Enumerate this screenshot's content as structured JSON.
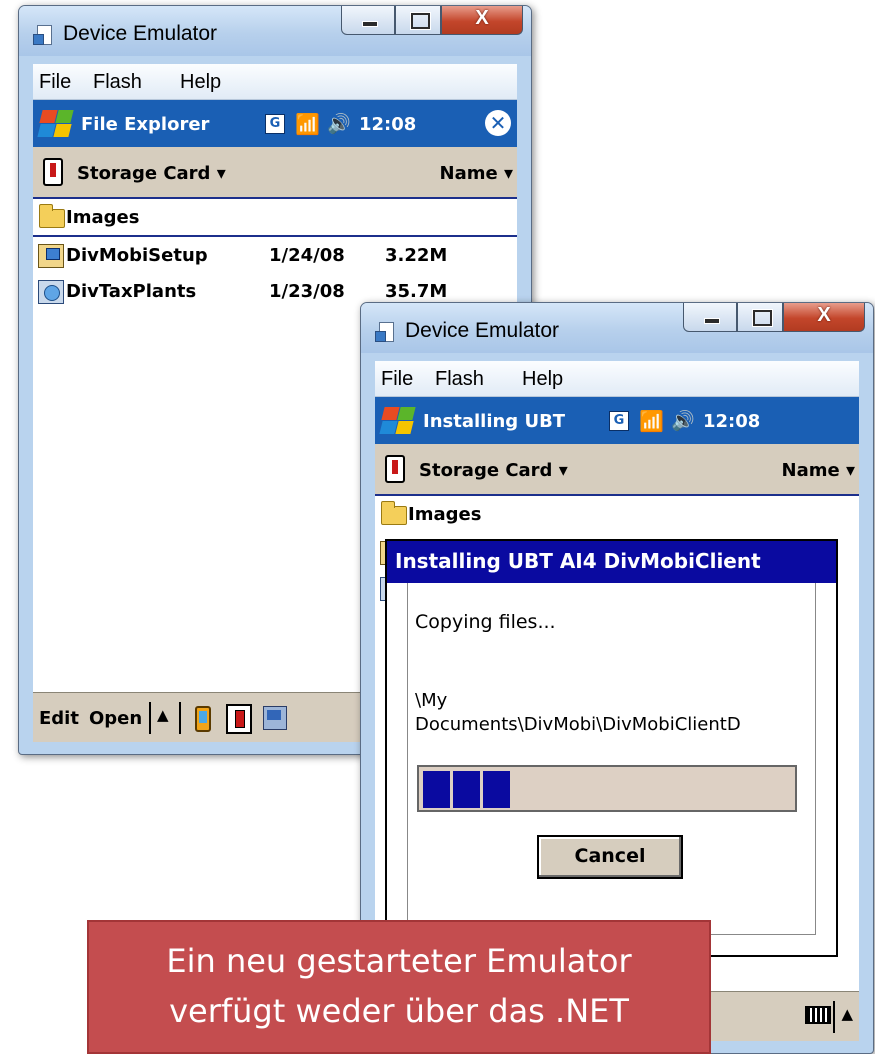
{
  "window_back": {
    "title": "Device Emulator",
    "menu": [
      "File",
      "Flash",
      "Help"
    ],
    "navbar": {
      "app_title": "File Explorer",
      "badge": "G",
      "clock": "12:08"
    },
    "storage": {
      "location": "Storage Card",
      "sort": "Name"
    },
    "folders": [
      {
        "name": "Images"
      }
    ],
    "files": [
      {
        "name": "DivMobiSetup",
        "date": "1/24/08",
        "size": "3.22M"
      },
      {
        "name": "DivTaxPlants",
        "date": "1/23/08",
        "size": "35.7M"
      }
    ],
    "bottom": {
      "edit": "Edit",
      "open": "Open"
    }
  },
  "window_front": {
    "title": "Device Emulator",
    "menu": [
      "File",
      "Flash",
      "Help"
    ],
    "navbar": {
      "app_title": "Installing UBT",
      "badge": "G",
      "clock": "12:08"
    },
    "storage": {
      "location": "Storage Card",
      "sort": "Name"
    },
    "folders": [
      {
        "name": "Images"
      }
    ],
    "dialog": {
      "title": "Installing UBT AI4 DivMobiClient",
      "status": "Copying files...",
      "path_line1": "\\My",
      "path_line2": "Documents\\DivMobi\\DivMobiClientD",
      "progress_blocks": 3,
      "cancel": "Cancel"
    }
  },
  "callout": {
    "line1": "Ein neu gestarteter Emulator",
    "line2": "verfügt weder über das .NET"
  },
  "icons": [
    "windows-flag-icon",
    "signal-icon",
    "speaker-icon",
    "close-circle-icon",
    "storage-card-icon",
    "folder-icon",
    "setup-package-icon",
    "application-icon",
    "pda-icon",
    "desktop-sync-icon",
    "keyboard-icon"
  ],
  "colors": {
    "navbar": "#1a5fb4",
    "dialog_title": "#0a0aa0",
    "toolbar": "#d6cdbe",
    "callout": "#c44d4f"
  }
}
